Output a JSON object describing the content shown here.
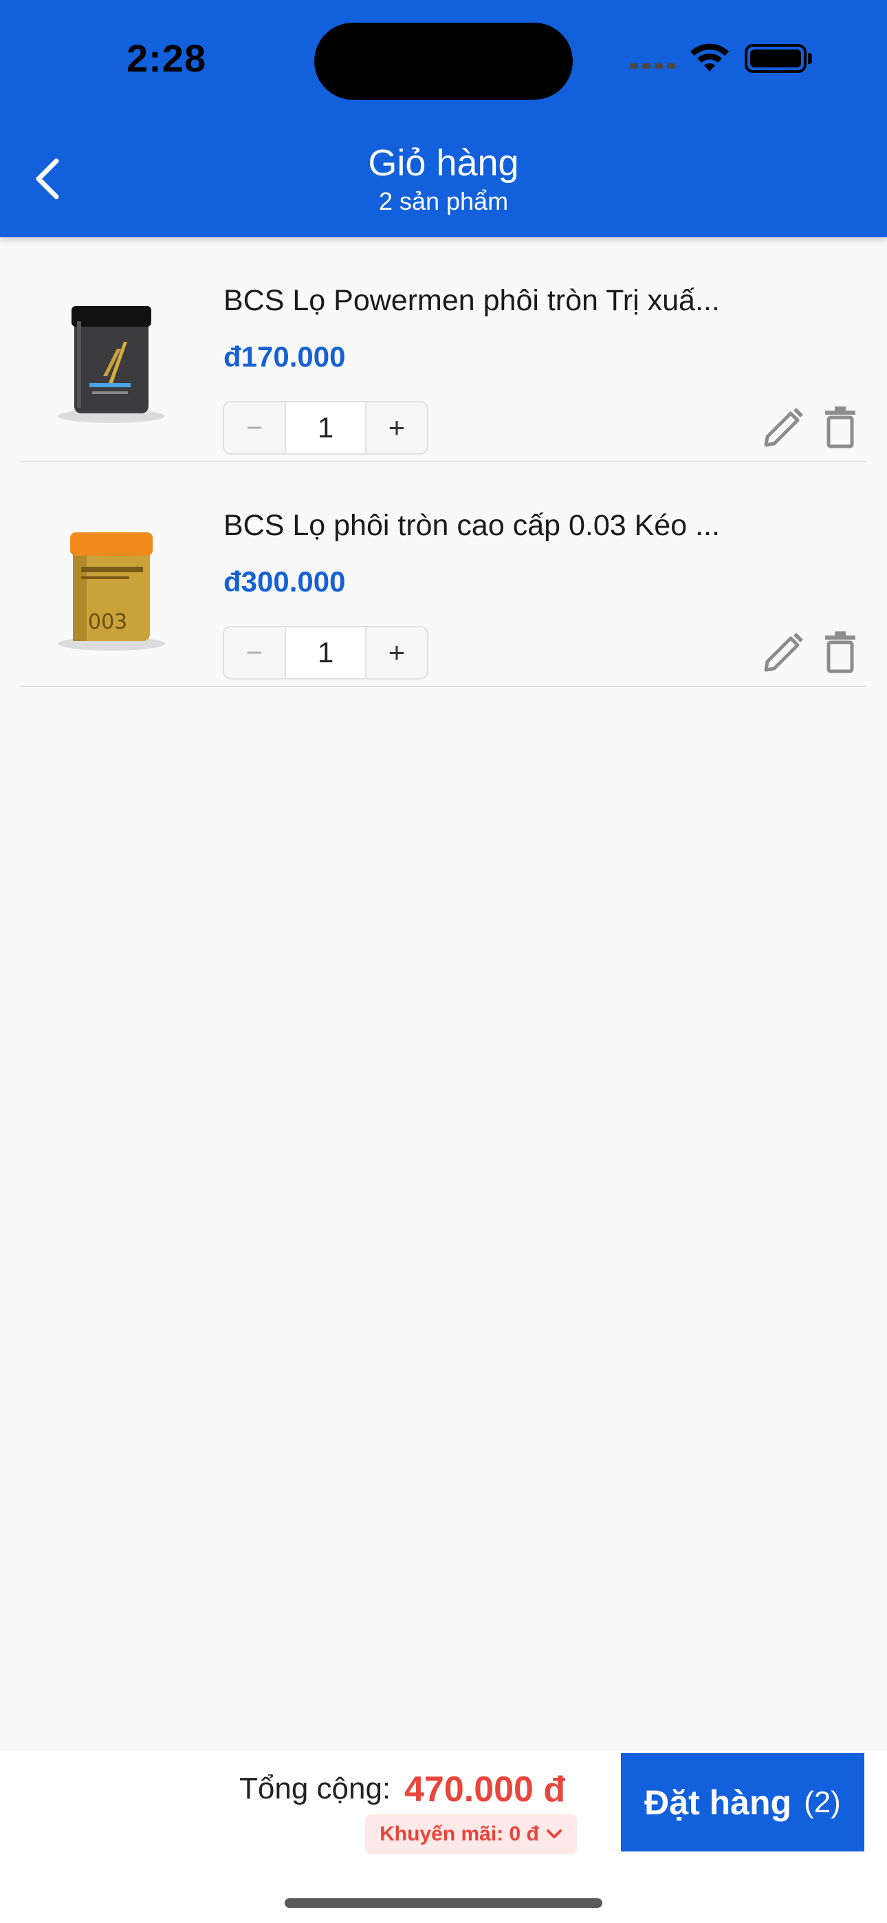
{
  "status_bar": {
    "time": "2:28"
  },
  "header": {
    "title": "Giỏ hàng",
    "subtitle": "2 sản phẩm"
  },
  "cart": {
    "items": [
      {
        "name": "BCS Lọ Powermen phôi tròn Trị xuấ...",
        "price": "đ170.000",
        "quantity": "1",
        "minus": "−",
        "plus": "+"
      },
      {
        "name": "BCS Lọ phôi tròn cao cấp 0.03 Kéo ...",
        "price": "đ300.000",
        "quantity": "1",
        "minus": "−",
        "plus": "+"
      }
    ]
  },
  "footer": {
    "total_label": "Tổng cộng:",
    "total_value": "470.000 đ",
    "promo_label": "Khuyến mãi: 0 đ",
    "order_label": "Đặt hàng",
    "order_count": "(2)"
  },
  "colors": {
    "primary": "#1260dc",
    "price": "#1761d4",
    "total": "#e8453c",
    "promo_bg": "#fde9e8"
  },
  "icons": [
    "back-arrow-icon",
    "wifi-icon",
    "battery-icon",
    "edit-pencil-icon",
    "trash-icon",
    "chevron-down-icon"
  ]
}
